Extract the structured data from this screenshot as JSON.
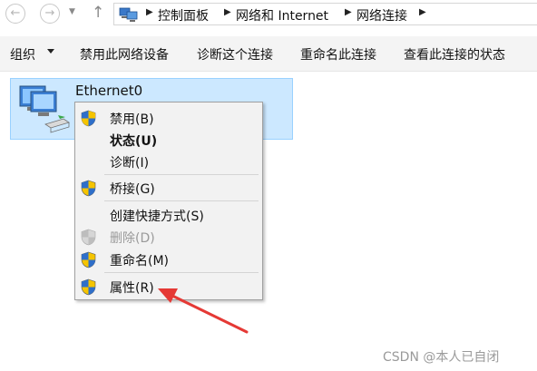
{
  "address_bar": {
    "crumbs": [
      "控制面板",
      "网络和 Internet",
      "网络连接"
    ]
  },
  "toolbar": {
    "organize": "组织",
    "disable": "禁用此网络设备",
    "diagnose": "诊断这个连接",
    "rename": "重命名此连接",
    "view_status": "查看此连接的状态"
  },
  "connection": {
    "name": "Ethernet0",
    "icon": "network-adapter-icon"
  },
  "context_menu": {
    "items": [
      {
        "label": "禁用(B)",
        "icon": "uac-shield-icon"
      },
      {
        "label": "状态(U)",
        "bold": true
      },
      {
        "label": "诊断(I)"
      },
      {
        "label": "桥接(G)",
        "icon": "uac-shield-icon"
      },
      {
        "label": "创建快捷方式(S)"
      },
      {
        "label": "删除(D)",
        "icon": "uac-shield-icon",
        "disabled": true
      },
      {
        "label": "重命名(M)",
        "icon": "uac-shield-icon"
      },
      {
        "label": "属性(R)",
        "icon": "uac-shield-icon"
      }
    ]
  },
  "annotation": {
    "arrow_color": "#e53935"
  },
  "watermark": "CSDN @本人已自闭"
}
